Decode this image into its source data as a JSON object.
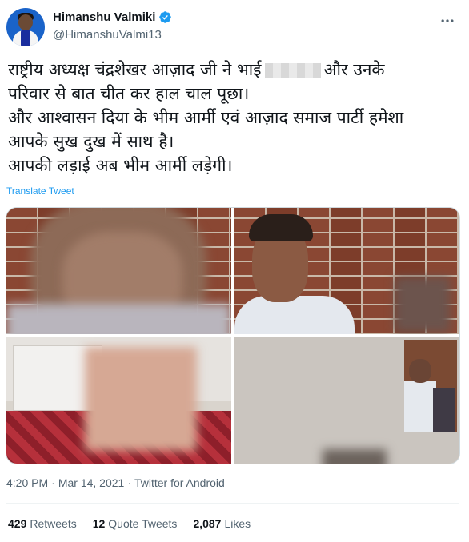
{
  "author": {
    "display_name": "Himanshu Valmiki",
    "handle": "@HimanshuValmi13",
    "verified": true
  },
  "tweet": {
    "lines": [
      "राष्ट्रीय अध्यक्ष चंद्रशेखर आज़ाद जी ने भाई",
      "और उनके",
      "परिवार से बात चीत कर हाल चाल पूछा।",
      "और आश्वासन दिया के भीम आर्मी एवं आज़ाद समाज पार्टी हमेशा",
      "आपके सुख दुख में साथ है।",
      "आपकी लड़ाई अब भीम आर्मी लड़ेगी।"
    ],
    "translate_label": "Translate Tweet"
  },
  "media": {
    "image_count": 4
  },
  "meta": {
    "time": "4:20 PM",
    "date": "Mar 14, 2021",
    "source": "Twitter for Android",
    "separator": "·"
  },
  "stats": {
    "retweets_count": "429",
    "retweets_label": "Retweets",
    "quotes_count": "12",
    "quotes_label": "Quote Tweets",
    "likes_count": "2,087",
    "likes_label": "Likes"
  },
  "icons": {
    "verified": "verified-badge-icon",
    "more": "more-horizontal-icon"
  },
  "colors": {
    "accent": "#1d9bf0",
    "text": "#0f1419",
    "muted": "#536471"
  }
}
